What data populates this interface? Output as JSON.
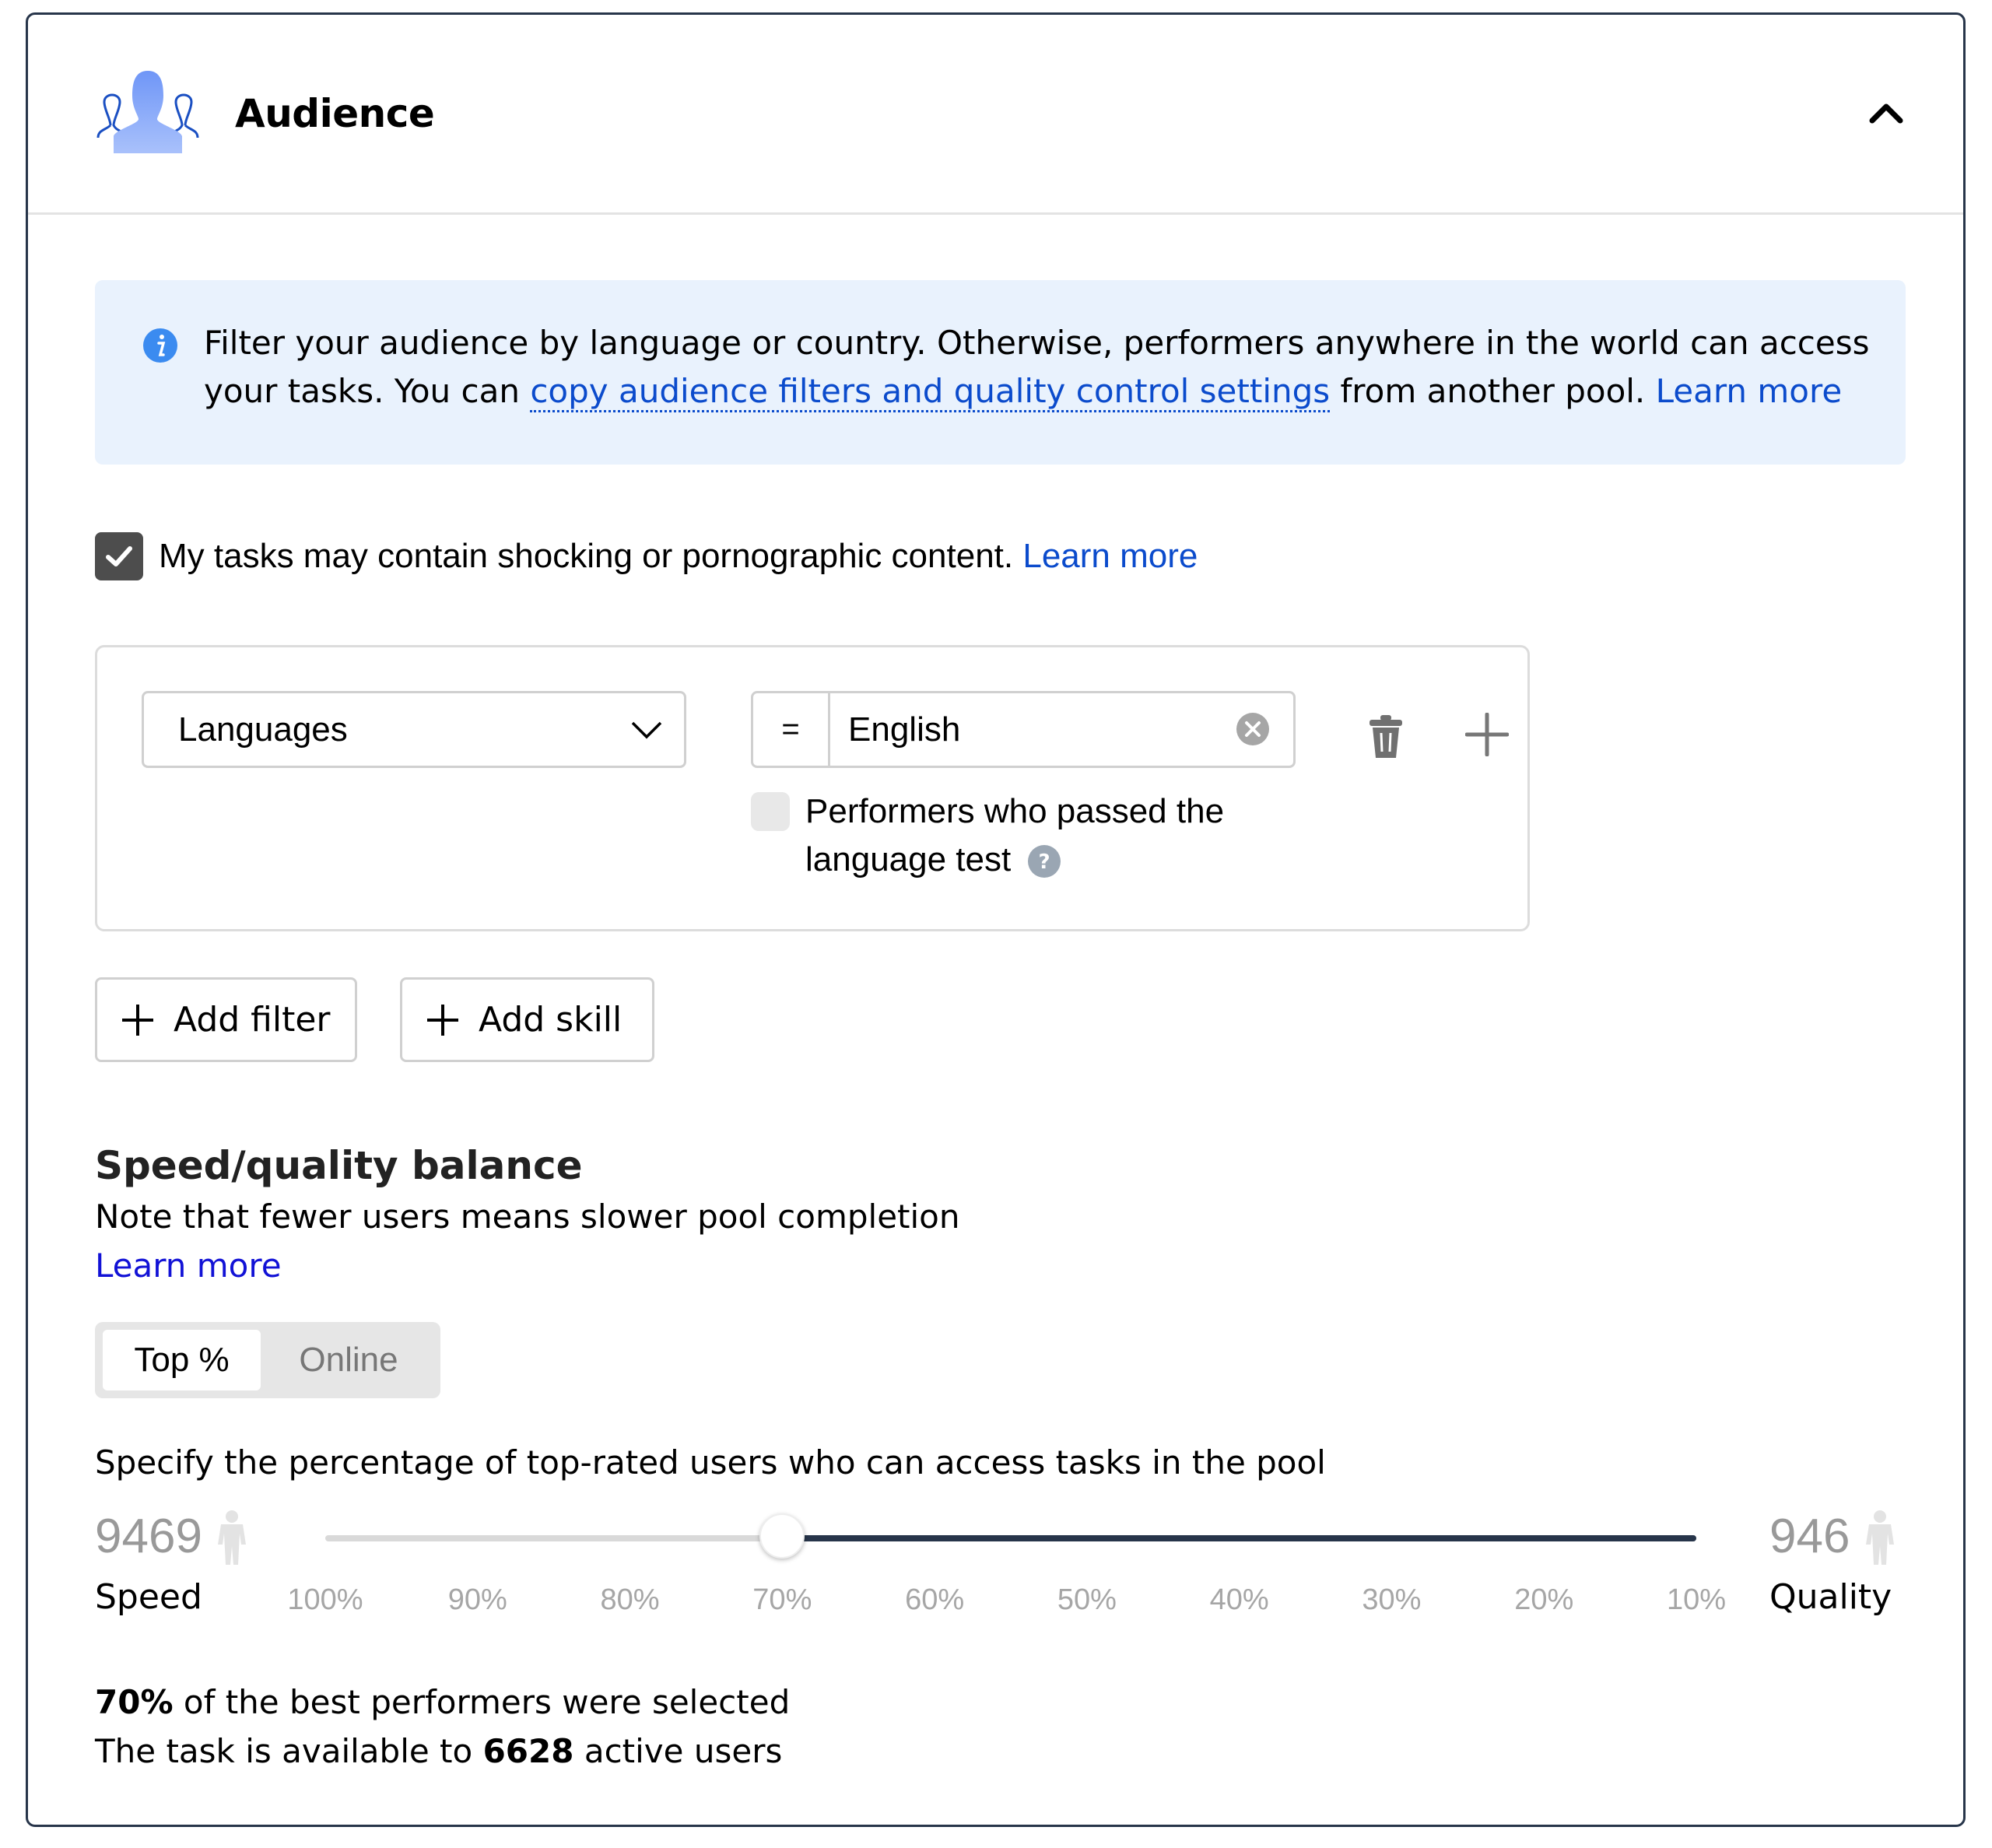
{
  "section": {
    "title": "Audience",
    "icon": "audience-icon",
    "collapse_icon": "chevron-up-icon"
  },
  "banner": {
    "icon": "info-icon",
    "text_before": "Filter your audience by language or country. Otherwise, performers anywhere in the world can access your tasks. You can ",
    "copy_link": "copy audience filters and quality control settings",
    "text_after": " from another pool. ",
    "learn_more": "Learn more"
  },
  "adult_content": {
    "checked": true,
    "label": "My tasks may contain shocking or pornographic content. ",
    "learn_more": "Learn more"
  },
  "filter": {
    "field": "Languages",
    "operator": "=",
    "value": "English",
    "language_test_checked": false,
    "language_test_label": "Performers who passed the language test",
    "icons": {
      "dropdown": "chevron-down-icon",
      "clear": "clear-icon",
      "delete": "trash-icon",
      "add": "plus-icon",
      "help": "question-icon"
    }
  },
  "buttons": {
    "add_filter": "Add filter",
    "add_skill": "Add skill"
  },
  "speed_quality": {
    "title": "Speed/quality balance",
    "note": "Note that fewer users means slower pool completion",
    "learn_more": "Learn more",
    "tabs": [
      {
        "label": "Top %",
        "active": true
      },
      {
        "label": "Online",
        "active": false
      }
    ],
    "description": "Specify the percentage of top-rated users who can access tasks in the pool",
    "speed_count": "9469",
    "speed_label": "Speed",
    "quality_count": "946",
    "quality_label": "Quality",
    "ticks": [
      "100%",
      "90%",
      "80%",
      "70%",
      "60%",
      "50%",
      "40%",
      "30%",
      "20%",
      "10%"
    ],
    "slider_value_percent": 70,
    "slider_min_percent": 10,
    "slider_max_percent": 100,
    "result_percent": "70%",
    "result_percent_suffix": " of the best performers were selected",
    "result_users_prefix": "The task is available to ",
    "result_users": "6628",
    "result_users_suffix": " active users"
  },
  "colors": {
    "link": "#0b4bcc",
    "banner_bg": "#e9f2fd",
    "slider_fill": "#27354a",
    "accent_icon": "#6f9cff"
  }
}
